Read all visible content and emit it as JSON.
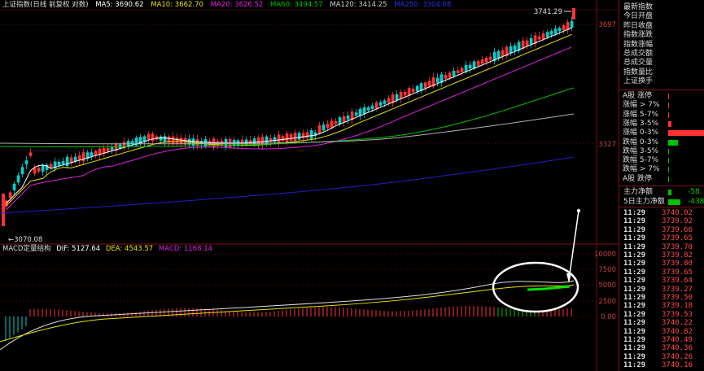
{
  "header": {
    "index_name": "上证指数(日线 前复权 对数)",
    "ma5": "MA5: 3690.62",
    "ma10": "MA10: 3662.70",
    "ma20": "MA20: 3626.52",
    "ma60": "MA60: 3494.57",
    "ma120": "MA120: 3414.25",
    "ma250": "MA250: 3304.08"
  },
  "macd_header": {
    "title": "MACD定量结构",
    "dif": "DIF: 5127.64",
    "dea": "DEA: 4543.57",
    "macd": "MACD: 1168.14"
  },
  "price_labels": {
    "high": "3741.29",
    "low": "3070.08",
    "axis_top": "3697",
    "axis_mid": "3327"
  },
  "macd_axis": [
    "10000",
    "7500",
    "5000",
    "2500",
    "0.00"
  ],
  "colors": {
    "up": "#ff3232",
    "down": "#00d0d0",
    "ma5": "#ffffff",
    "ma10": "#e8e000",
    "ma20": "#e020e0",
    "ma60": "#00c000",
    "ma120": "#b0b0b0",
    "ma250": "#2020c8",
    "annotation": "#ffffff"
  },
  "stats": [
    "最新指数",
    "今日开盘",
    "昨日收盘",
    "指数涨跌",
    "指数涨幅",
    "总成交额",
    "总成交量",
    "指数量比",
    "上证换手"
  ],
  "distribution": [
    {
      "label": "A股  涨停",
      "value": 0.01,
      "color": "#ff3232"
    },
    {
      "label": "涨幅 > 7%",
      "value": 0.02,
      "color": "#ff3232"
    },
    {
      "label": "涨幅 5-7%",
      "value": 0.03,
      "color": "#ff3232"
    },
    {
      "label": "涨幅 3-5%",
      "value": 0.08,
      "color": "#ff3232"
    },
    {
      "label": "涨幅 0-3%",
      "value": 1.0,
      "color": "#ff3232"
    },
    {
      "label": "跌幅 0-3%",
      "value": 0.28,
      "color": "#00c000"
    },
    {
      "label": "跌幅 3-5%",
      "value": 0.01,
      "color": "#00c000"
    },
    {
      "label": "跌幅 5-7%",
      "value": 0.01,
      "color": "#00c000"
    },
    {
      "label": "跌幅 > 7%",
      "value": 0.01,
      "color": "#00c000"
    },
    {
      "label": "A股  跌停",
      "value": 0.01,
      "color": "#00c000"
    }
  ],
  "flows": [
    {
      "label": "主力净额",
      "value": "-58.",
      "bar": 0.1
    },
    {
      "label": "5日主力净额",
      "value": "-438",
      "bar": 0.35
    }
  ],
  "ticks": [
    {
      "time": "11:29",
      "price": "3740.02"
    },
    {
      "time": "11:29",
      "price": "3739.92"
    },
    {
      "time": "11:29",
      "price": "3739.66"
    },
    {
      "time": "11:29",
      "price": "3739.65"
    },
    {
      "time": "11:29",
      "price": "3739.70"
    },
    {
      "time": "11:29",
      "price": "3739.82"
    },
    {
      "time": "11:29",
      "price": "3739.80"
    },
    {
      "time": "11:29",
      "price": "3739.65"
    },
    {
      "time": "11:29",
      "price": "3739.64"
    },
    {
      "time": "11:29",
      "price": "3739.27"
    },
    {
      "time": "11:29",
      "price": "3739.50"
    },
    {
      "time": "11:29",
      "price": "3739.18"
    },
    {
      "time": "11:29",
      "price": "3739.53"
    },
    {
      "time": "11:29",
      "price": "3740.22"
    },
    {
      "time": "11:29",
      "price": "3740.82"
    },
    {
      "time": "11:29",
      "price": "3740.49"
    },
    {
      "time": "11:29",
      "price": "3740.36"
    },
    {
      "time": "11:29",
      "price": "3740.26"
    },
    {
      "time": "11:29",
      "price": "3740.16"
    }
  ]
}
